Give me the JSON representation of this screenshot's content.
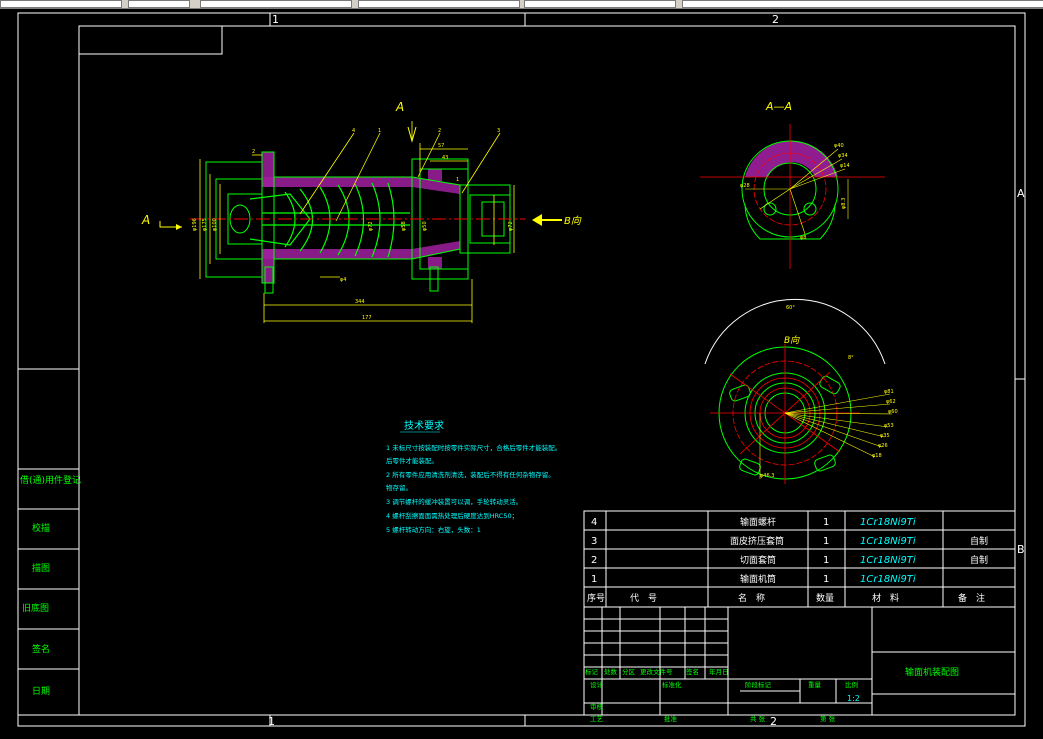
{
  "colors": {
    "background": "#000000",
    "frame": "#ffffff",
    "dimension": "#ffff00",
    "outline": "#00ff00",
    "hatch": "#cc33cc",
    "centerline": "#ff0000",
    "text_cyan": "#00ffff"
  },
  "zones": {
    "top_1": "1",
    "top_2": "2",
    "bottom_1": "1",
    "bottom_2": "2",
    "right_A": "A",
    "right_B": "B"
  },
  "section_marks": {
    "a_top": "A",
    "a_left": "A",
    "section_label": "A—A",
    "b_view_arrow": "B向",
    "b_view_label": "B向"
  },
  "tech_requirements": {
    "title": "技术要求",
    "items": [
      "1  未标尺寸按装配时按零件实际尺寸，合格后零件才能装配。",
      "后零件才能装配。",
      "2  所有零件应用清洗剂清洗，装配后不得有任何杂物存留。",
      "物存留。",
      "3  调节螺杆的缓冲装置可以调，手轮转动灵活。",
      "4  螺杆刮擦面面需热处理后硬度达到HRC50；",
      "5  螺杆转动方向：右旋，头数：1"
    ]
  },
  "bom": {
    "rows": [
      {
        "no": "4",
        "name": "输面螺杆",
        "qty": "1",
        "material": "1Cr18Ni9Ti",
        "note": ""
      },
      {
        "no": "3",
        "name": "面皮挤压套筒",
        "qty": "1",
        "material": "1Cr18Ni9Ti",
        "note": "自制"
      },
      {
        "no": "2",
        "name": "切面套筒",
        "qty": "1",
        "material": "1Cr18Ni9Ti",
        "note": "自制"
      },
      {
        "no": "1",
        "name": "输面机筒",
        "qty": "1",
        "material": "1Cr18Ni9Ti",
        "note": ""
      }
    ],
    "header": {
      "no": "序号",
      "code": "代　号",
      "name": "名　称",
      "qty": "数量",
      "material": "材　料",
      "note": "备　注"
    }
  },
  "title_block": {
    "drawing_name": "输面机装配图",
    "scale": "1:2",
    "labels": [
      "标记",
      "处数",
      "分区",
      "更改文件号",
      "签名",
      "年月日",
      "设计",
      "标准化",
      "阶段标记",
      "重量",
      "比例",
      "审核",
      "工艺",
      "批准",
      "共  张",
      "第  张"
    ]
  },
  "left_strip": [
    "借(通)用件登记",
    "旧底图",
    "签名",
    "日期",
    "描图",
    "校描"
  ]
}
